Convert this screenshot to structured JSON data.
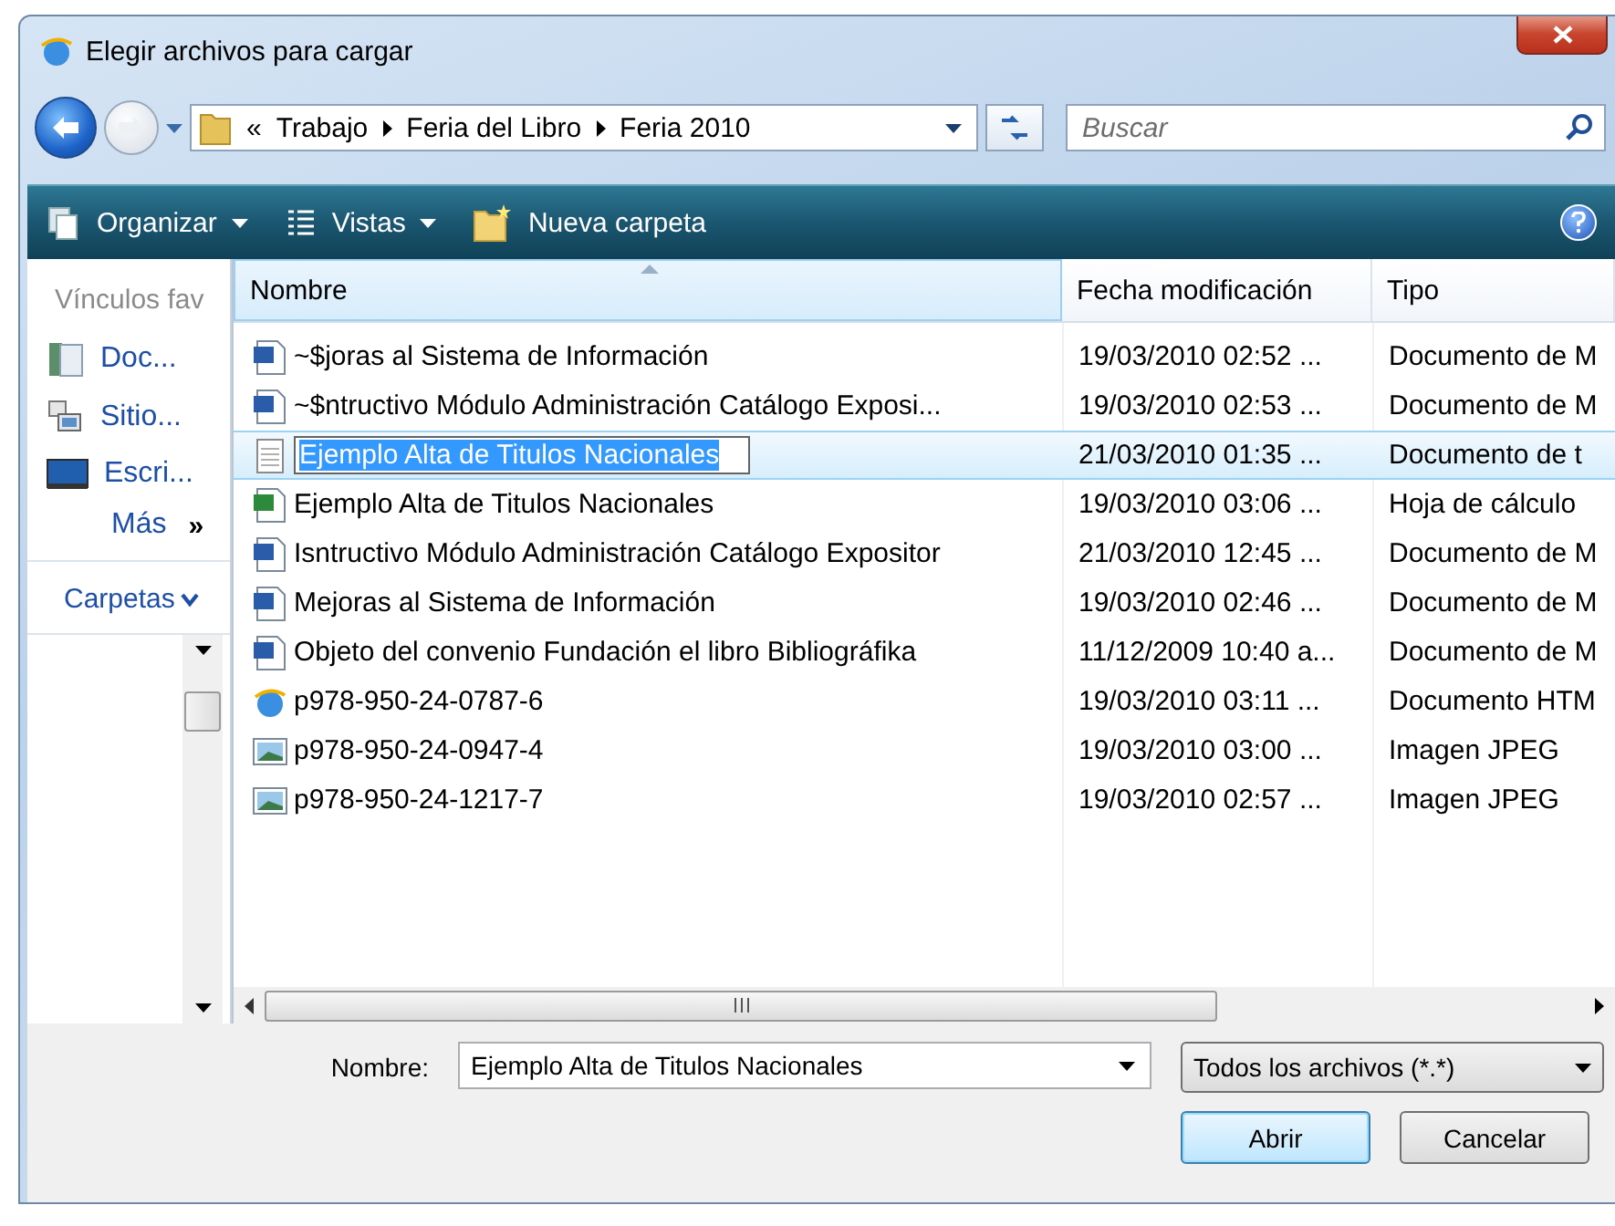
{
  "window": {
    "title": "Elegir archivos para cargar"
  },
  "address": {
    "overflow": "«",
    "crumbs": [
      "Trabajo",
      "Feria del Libro",
      "Feria 2010"
    ]
  },
  "search": {
    "placeholder": "Buscar"
  },
  "toolbar": [
    {
      "label": "Organizar",
      "dropdown": true
    },
    {
      "label": "Vistas",
      "dropdown": true
    },
    {
      "label": "Nueva carpeta",
      "dropdown": false
    }
  ],
  "sidebar": {
    "header": "Vínculos fav",
    "links": [
      {
        "label": "Doc...",
        "kind": "documents"
      },
      {
        "label": "Sitio...",
        "kind": "sites"
      },
      {
        "label": "Escri...",
        "kind": "desktop"
      }
    ],
    "more": "Más",
    "more_glyph": "»",
    "folders": "Carpetas"
  },
  "table": {
    "columns": [
      "Nombre",
      "Fecha modificación",
      "Tipo"
    ],
    "rows": [
      {
        "name": "~$joras al Sistema de Información",
        "date": "19/03/2010 02:52 ...",
        "type": "Documento de M",
        "kind": "word",
        "selected": false
      },
      {
        "name": "~$ntructivo Módulo Administración Catálogo Exposi...",
        "date": "19/03/2010 02:53 ...",
        "type": "Documento de M",
        "kind": "word",
        "selected": false
      },
      {
        "name": "Ejemplo Alta de Titulos Nacionales",
        "date": "21/03/2010 01:35 ...",
        "type": "Documento de t",
        "kind": "text",
        "selected": true
      },
      {
        "name": "Ejemplo Alta de Titulos Nacionales",
        "date": "19/03/2010 03:06 ...",
        "type": "Hoja de cálculo",
        "kind": "excel",
        "selected": false
      },
      {
        "name": "Isntructivo Módulo Administración Catálogo Expositor",
        "date": "21/03/2010 12:45 ...",
        "type": "Documento de M",
        "kind": "word",
        "selected": false
      },
      {
        "name": "Mejoras al Sistema de Información",
        "date": "19/03/2010 02:46 ...",
        "type": "Documento de M",
        "kind": "word",
        "selected": false
      },
      {
        "name": "Objeto del convenio Fundación el libro Bibliográfika",
        "date": "11/12/2009 10:40 a...",
        "type": "Documento de M",
        "kind": "word",
        "selected": false
      },
      {
        "name": "p978-950-24-0787-6",
        "date": "19/03/2010 03:11 ...",
        "type": "Documento HTM",
        "kind": "html",
        "selected": false
      },
      {
        "name": "p978-950-24-0947-4",
        "date": "19/03/2010 03:00 ...",
        "type": "Imagen JPEG",
        "kind": "image",
        "selected": false
      },
      {
        "name": "p978-950-24-1217-7",
        "date": "19/03/2010 02:57 ...",
        "type": "Imagen JPEG",
        "kind": "image",
        "selected": false
      }
    ]
  },
  "footer": {
    "name_label": "Nombre:",
    "name_value": "Ejemplo Alta de Titulos Nacionales",
    "filter": "Todos los archivos (*.*)",
    "buttons": [
      {
        "label": "Abrir",
        "default": true
      },
      {
        "label": "Cancelar",
        "default": false
      }
    ]
  }
}
